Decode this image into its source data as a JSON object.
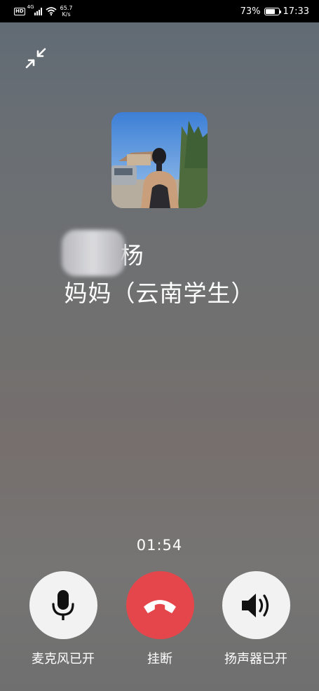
{
  "status_bar": {
    "network_type": "4G",
    "speed_value": "65.7",
    "speed_unit": "K/s",
    "battery_percent": "73%",
    "battery_level": 0.73,
    "time": "17:33"
  },
  "call": {
    "caller_name_prefix": "杨",
    "caller_name_rest": "妈妈（云南学生）",
    "duration": "01:54"
  },
  "controls": {
    "mute_label": "麦克风已开",
    "hangup_label": "挂断",
    "speaker_label": "扬声器已开"
  },
  "icons": {
    "minimize": "minimize-icon",
    "microphone": "microphone-icon",
    "hangup": "phone-hangup-icon",
    "speaker": "speaker-icon"
  },
  "colors": {
    "hangup_red": "#e5464b",
    "control_white": "#f2f2f2"
  }
}
